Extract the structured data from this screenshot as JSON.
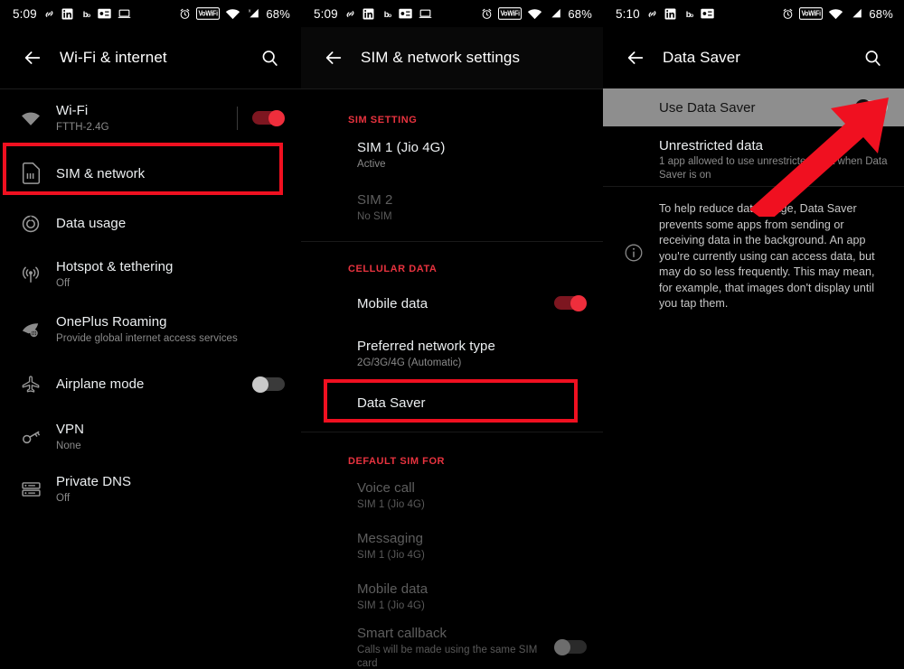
{
  "status_bar": {
    "time_left": "5:09",
    "time_right": "5:10",
    "battery": "68%",
    "vowifi_label": "VoWiFi",
    "icons": [
      "link-icon",
      "linkedin-icon",
      "bb-icon",
      "card-icon",
      "laptop-icon",
      "alarm-icon",
      "vowifi-badge",
      "wifi-icon",
      "cellular-signal-icon"
    ]
  },
  "panel1": {
    "title": "Wi-Fi & internet",
    "rows": [
      {
        "title": "Wi-Fi",
        "subtitle": "FTTH-2.4G",
        "icon": "wifi-icon",
        "toggle": "on"
      },
      {
        "title": "SIM & network",
        "subtitle": "",
        "icon": "sim-card-icon",
        "toggle": "none"
      },
      {
        "title": "Data usage",
        "subtitle": "",
        "icon": "data-usage-icon",
        "toggle": "none"
      },
      {
        "title": "Hotspot & tethering",
        "subtitle": "Off",
        "icon": "hotspot-icon",
        "toggle": "none"
      },
      {
        "title": "OnePlus Roaming",
        "subtitle": "Provide global internet access services",
        "icon": "roaming-icon",
        "toggle": "none"
      },
      {
        "title": "Airplane mode",
        "subtitle": "",
        "icon": "airplane-icon",
        "toggle": "off"
      },
      {
        "title": "VPN",
        "subtitle": "None",
        "icon": "key-icon",
        "toggle": "none"
      },
      {
        "title": "Private DNS",
        "subtitle": "Off",
        "icon": "dns-icon",
        "toggle": "none"
      }
    ]
  },
  "panel2": {
    "title": "SIM & network settings",
    "section_sim": "SIM SETTING",
    "section_cellular": "CELLULAR DATA",
    "section_default": "DEFAULT SIM FOR",
    "sim_rows": [
      {
        "title": "SIM 1  (Jio 4G)",
        "subtitle": "Active",
        "dim": false
      },
      {
        "title": "SIM 2",
        "subtitle": "No SIM",
        "dim": true
      }
    ],
    "cellular_rows": [
      {
        "title": "Mobile data",
        "subtitle": "",
        "toggle": "on"
      },
      {
        "title": "Preferred network type",
        "subtitle": "2G/3G/4G (Automatic)",
        "toggle": "none"
      },
      {
        "title": "Data Saver",
        "subtitle": "",
        "toggle": "none"
      }
    ],
    "default_rows": [
      {
        "title": "Voice call",
        "subtitle": "SIM 1  (Jio 4G)",
        "toggle": "none"
      },
      {
        "title": "Messaging",
        "subtitle": "SIM 1  (Jio 4G)",
        "toggle": "none"
      },
      {
        "title": "Mobile data",
        "subtitle": "SIM 1  (Jio 4G)",
        "toggle": "none"
      },
      {
        "title": "Smart callback",
        "subtitle": "Calls will be made using the same SIM card",
        "toggle": "offdim"
      }
    ]
  },
  "panel3": {
    "title": "Data Saver",
    "use_data_saver_label": "Use Data Saver",
    "use_data_saver_state": "off",
    "unrestricted_title": "Unrestricted data",
    "unrestricted_subtitle": "1 app allowed to use unrestricted data when Data Saver is on",
    "info_text": "To help reduce data usage, Data Saver prevents some apps from sending or receiving data in the background. An app you're currently using can access data, but may do so less frequently. This may mean, for example, that images don't display until you tap them.",
    "info_icon": "info-icon"
  },
  "annotations": {
    "highlight_color": "#f01020",
    "box1_target": "SIM & network",
    "box2_target": "Data Saver",
    "arrow_target": "use-data-saver-toggle"
  }
}
